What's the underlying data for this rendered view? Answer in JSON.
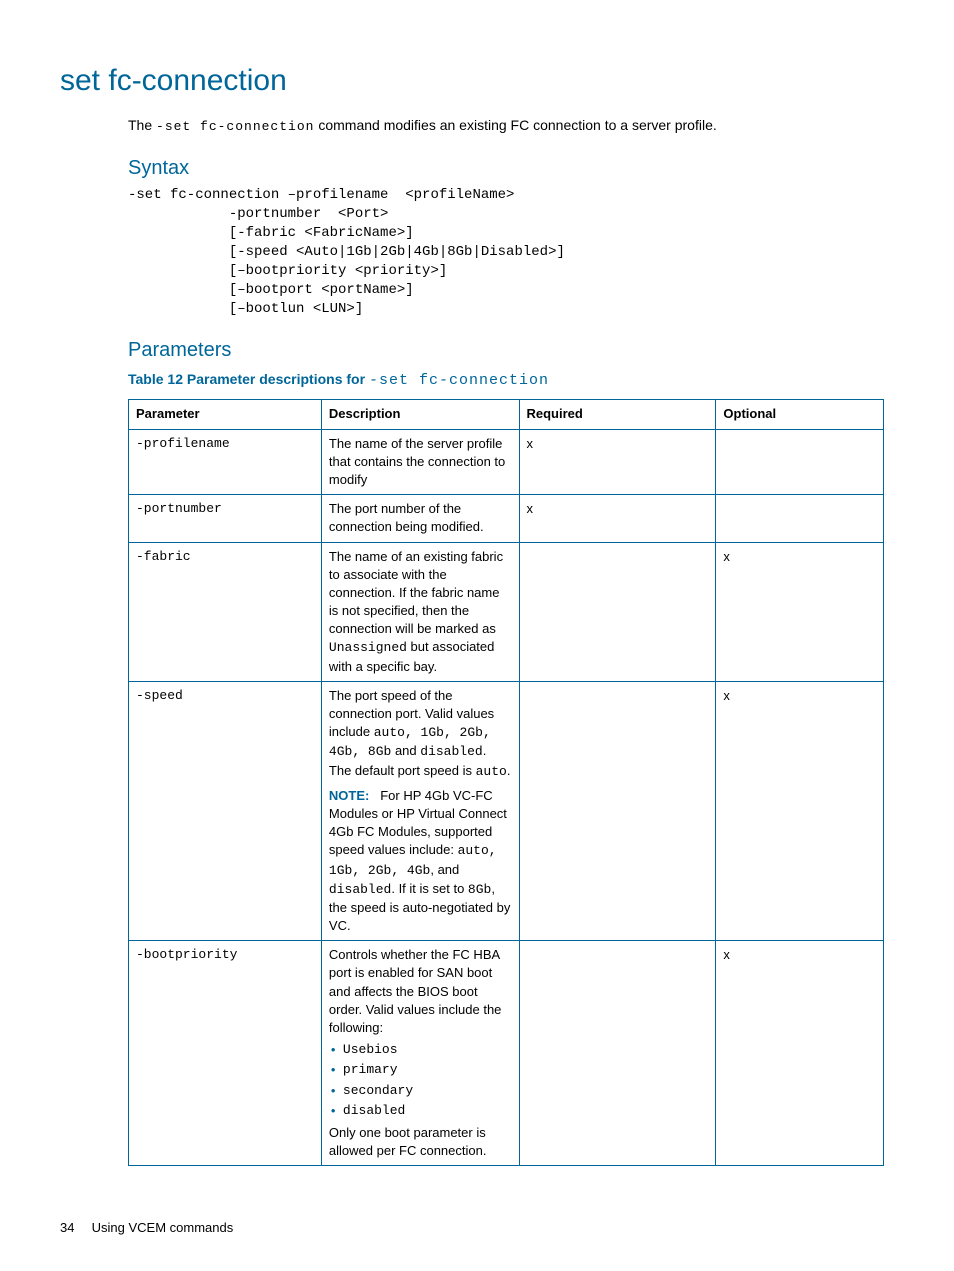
{
  "section": {
    "title": "set fc-connection",
    "intro_pre": "The ",
    "intro_cmd": "-set fc-connection",
    "intro_post": " command modifies an existing FC connection to a server profile."
  },
  "syntax": {
    "heading": "Syntax",
    "lines": "-set fc-connection –profilename  <profileName>\n            -portnumber  <Port>\n            [-fabric <FabricName>]\n            [-speed <Auto|1Gb|2Gb|4Gb|8Gb|Disabled>]\n            [–bootpriority <priority>]\n            [–bootport <portName>]\n            [–bootlun <LUN>]"
  },
  "parameters": {
    "heading": "Parameters",
    "caption_prefix": "Table 12 Parameter descriptions for ",
    "caption_cmd": "-set fc-connection",
    "headers": {
      "param": "Parameter",
      "desc": "Description",
      "req": "Required",
      "opt": "Optional"
    },
    "rows": {
      "profilename": {
        "param": "-profilename",
        "desc": "The name of the server profile that contains the connection to modify",
        "req": "x",
        "opt": ""
      },
      "portnumber": {
        "param": "-portnumber",
        "desc": "The port number of the connection being modified.",
        "req": "x",
        "opt": ""
      },
      "fabric": {
        "param": "-fabric",
        "desc_pre": "The name of an existing fabric to associate with the connection. If the fabric name is not specified, then the connection will be marked as ",
        "desc_mono": "Unassigned",
        "desc_post": " but associated with a specific bay.",
        "req": "",
        "opt": "x"
      },
      "speed": {
        "param": "-speed",
        "desc_p1_pre": "The port speed of the connection port. Valid values include ",
        "desc_p1_list": "auto, 1Gb, 2Gb, 4Gb, 8Gb",
        "desc_p1_mid": " and ",
        "desc_p1_disabled": "disabled",
        "desc_p1_post": ". The default port speed is ",
        "desc_p1_auto": "auto",
        "desc_p1_end": ".",
        "note_label": "NOTE:",
        "note_text_pre": "For HP 4Gb VC-FC Modules or HP Virtual Connect 4Gb FC Modules, supported speed values include: ",
        "note_list": "auto, 1Gb, 2Gb, 4Gb",
        "note_mid1": ", and ",
        "note_disabled": "disabled",
        "note_mid2": ". If it is set to ",
        "note_8gb": "8Gb",
        "note_post": ", the speed is auto-negotiated by VC.",
        "req": "",
        "opt": "x"
      },
      "bootpriority": {
        "param": "-bootpriority",
        "desc_intro": "Controls whether the FC HBA port is enabled for SAN boot and affects the BIOS boot order. Valid values include the following:",
        "bullets": [
          "Usebios",
          "primary",
          "secondary",
          "disabled"
        ],
        "desc_outro": "Only one boot parameter is allowed per FC connection.",
        "req": "",
        "opt": "x"
      }
    }
  },
  "footer": {
    "page_number": "34",
    "chapter": "Using VCEM commands"
  }
}
